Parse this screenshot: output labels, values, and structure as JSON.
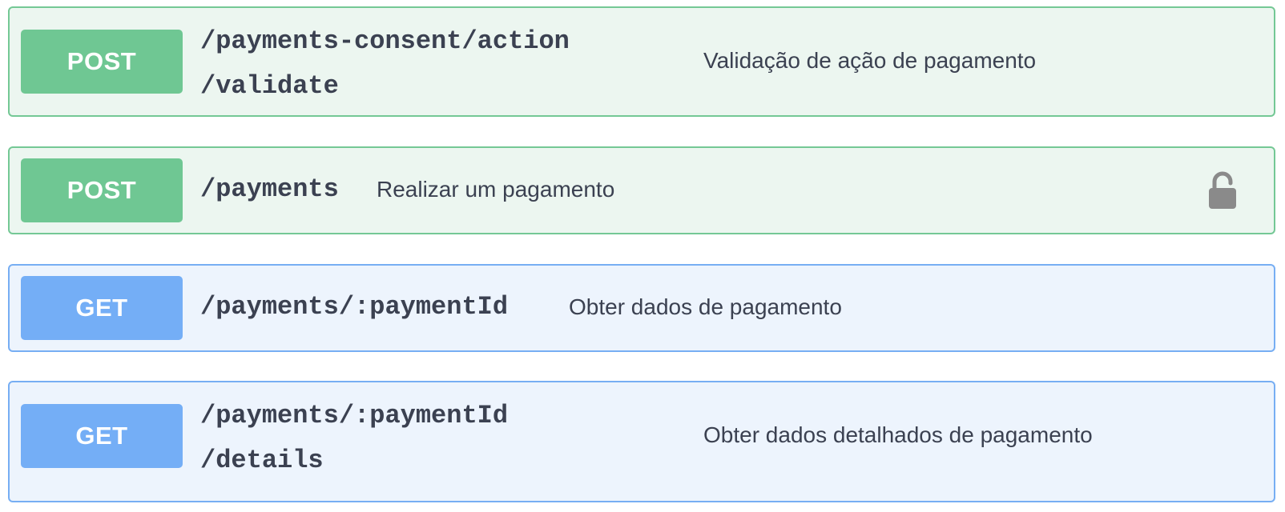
{
  "operations": [
    {
      "method": "POST",
      "path_line1": "/payments-consent/action",
      "path_line2": "/validate",
      "summary": "Validação de ação de pagamento"
    },
    {
      "method": "POST",
      "path_line1": "/payments",
      "summary": "Realizar um pagamento",
      "icon": "unlocked-padlock-icon"
    },
    {
      "method": "GET",
      "path_line1": "/payments/:paymentId",
      "summary": "Obter dados de pagamento"
    },
    {
      "method": "GET",
      "path_line1": "/payments/:paymentId",
      "path_line2": "/details",
      "summary": "Obter dados detalhados de pagamento"
    }
  ],
  "colors": {
    "post_bg": "#ecf6f0",
    "post_border": "#74c895",
    "post_badge": "#6fc793",
    "get_bg": "#edf4fd",
    "get_border": "#77aef3",
    "get_badge": "#74aef6",
    "text": "#3b4151",
    "lock": "#8a8a8a"
  }
}
